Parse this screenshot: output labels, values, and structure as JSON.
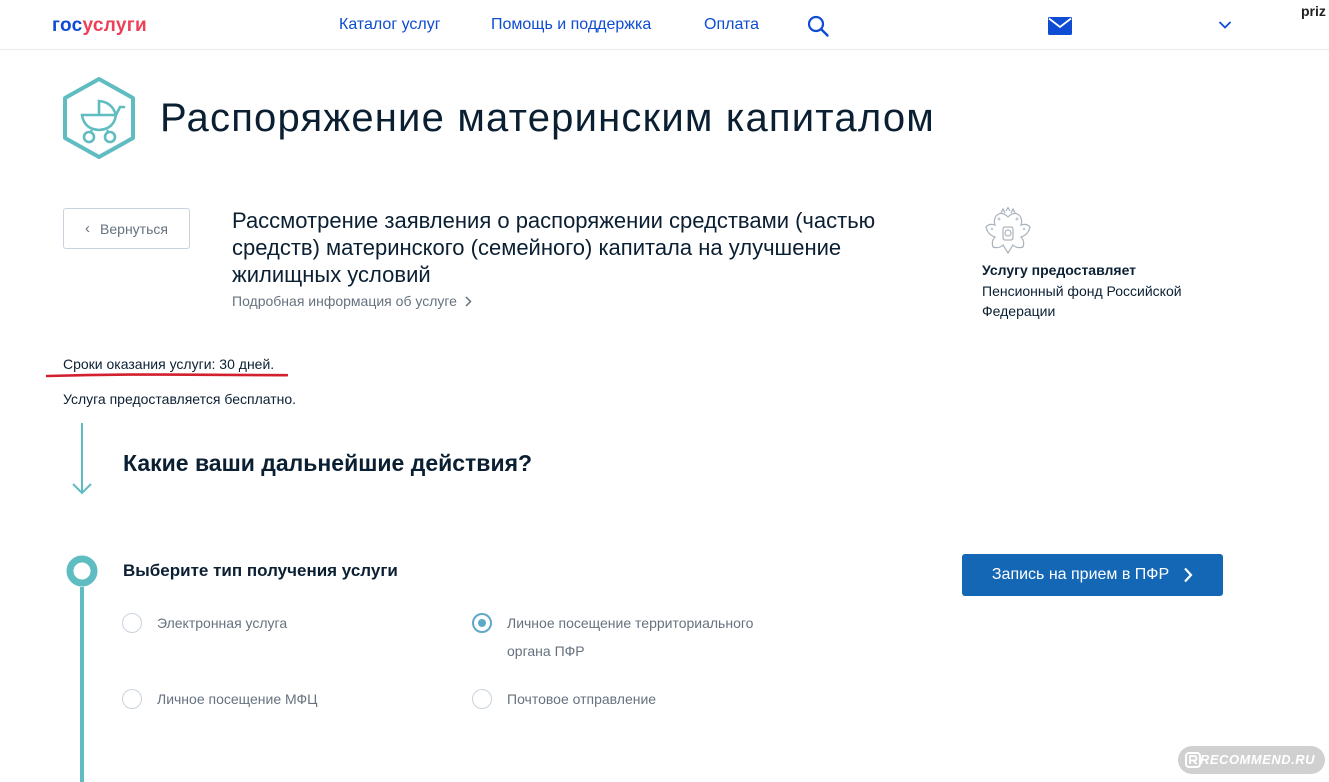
{
  "header": {
    "logo": {
      "gos": "гос",
      "uslugi": "услуги"
    },
    "nav": [
      {
        "label": "Каталог услуг"
      },
      {
        "label": "Помощь и поддержка"
      },
      {
        "label": "Оплата"
      }
    ],
    "search_icon": "search-icon",
    "mail_icon": "mail-icon",
    "user_name": "priz"
  },
  "page": {
    "title": "Распоряжение материнским капиталом",
    "icon": "baby-carriage-icon"
  },
  "service": {
    "back_label": "Вернуться",
    "name": "Рассмотрение заявления о распоряжении средствами (частью средств) материнского (семейного) капитала на улучшение жилищных условий",
    "details_link": "Подробная информация об услуге",
    "provider_label": "Услугу предоставляет",
    "provider_name": "Пенсионный фонд Российской Федерации",
    "term": "Сроки оказания услуги: 30 дней.",
    "price": "Услуга предоставляется бесплатно."
  },
  "steps": {
    "heading": "Какие ваши дальнейшие действия?",
    "step_title": "Выберите тип получения услуги",
    "options": [
      {
        "label": "Электронная услуга",
        "checked": false
      },
      {
        "label": "Личное посещение территориального органа ПФР",
        "checked": true
      },
      {
        "label": "Личное посещение МФЦ",
        "checked": false
      },
      {
        "label": "Почтовое отправление",
        "checked": false
      }
    ],
    "appointment_button": "Запись на прием в ПФР"
  },
  "watermark": "RECOMMEND.RU",
  "colors": {
    "brand_blue": "#0d4cd3",
    "brand_red": "#ee3f58",
    "teal": "#5fbcc1",
    "button_blue": "#1467b5",
    "underline_red": "#d2202f"
  }
}
